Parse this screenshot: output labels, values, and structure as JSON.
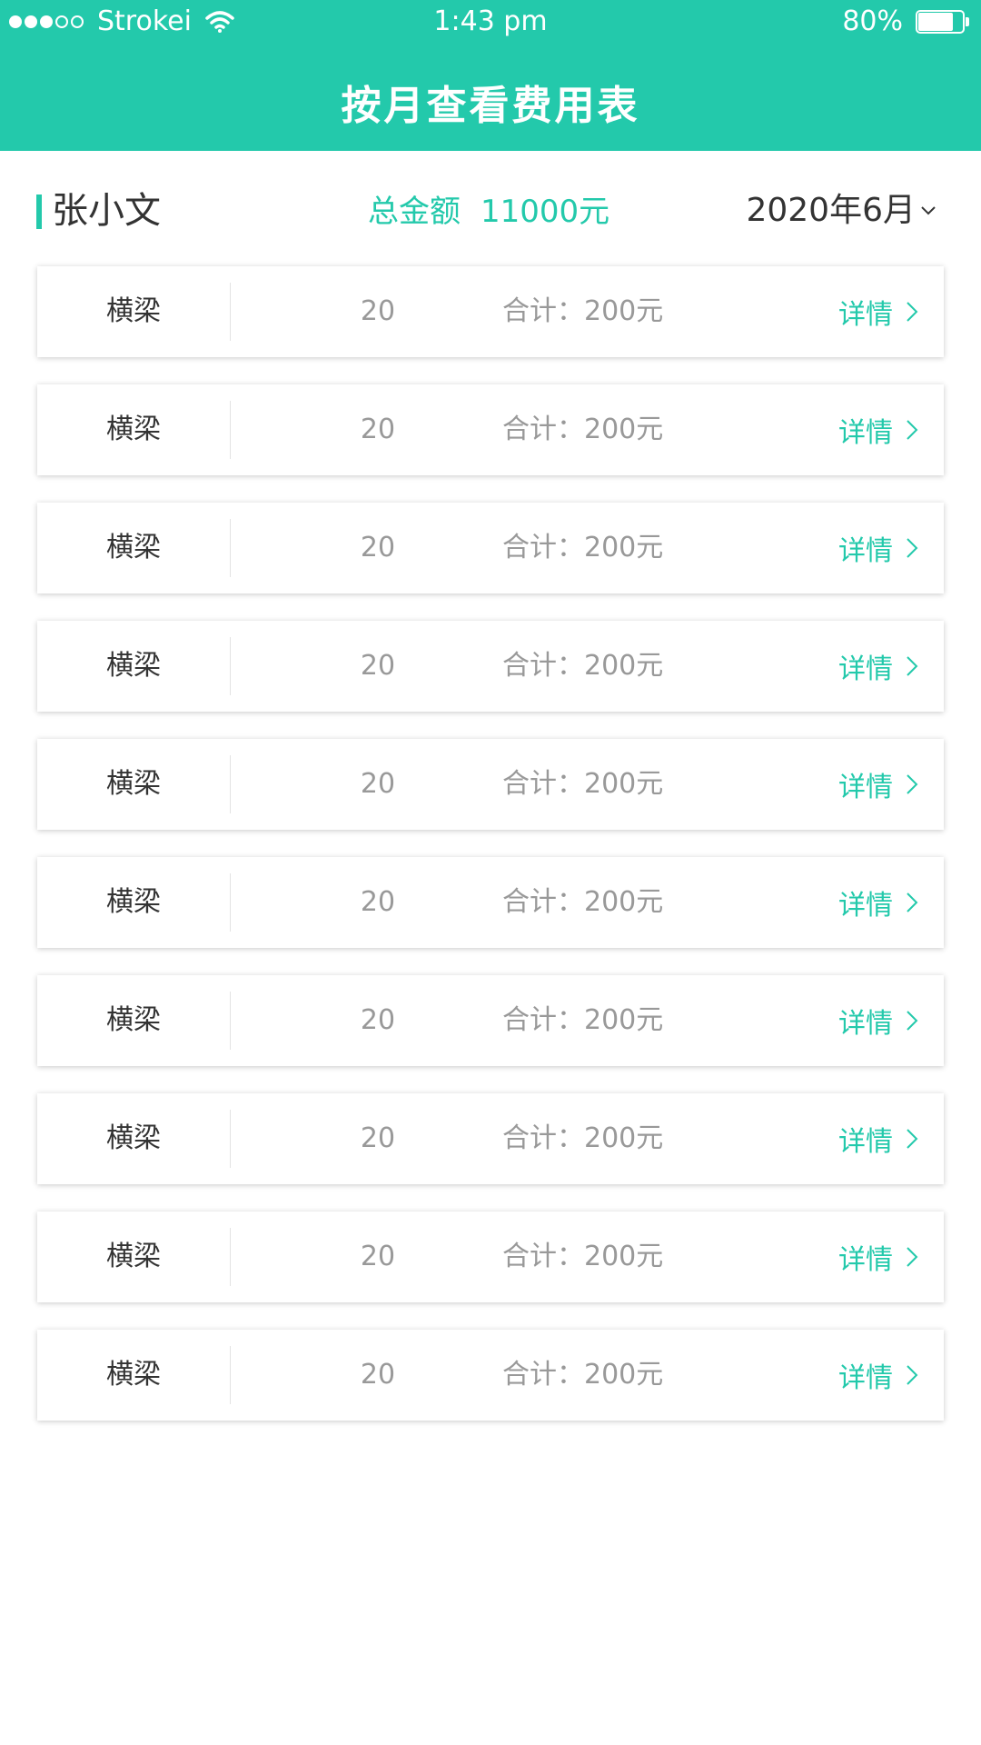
{
  "status_bar": {
    "carrier": "Strokei",
    "time": "1:43 pm",
    "battery": "80%",
    "battery_level": 0.8,
    "signal_bars_filled": 3,
    "signal_bars_total": 5
  },
  "header": {
    "title": "按月查看费用表"
  },
  "summary": {
    "name": "张小文",
    "total_label": "总金额",
    "total_value": "11000元",
    "month": "2020年6月"
  },
  "items": [
    {
      "name": "横梁",
      "quantity": "20",
      "total": "合计：200元",
      "detail": "详情"
    },
    {
      "name": "横梁",
      "quantity": "20",
      "total": "合计：200元",
      "detail": "详情"
    },
    {
      "name": "横梁",
      "quantity": "20",
      "total": "合计：200元",
      "detail": "详情"
    },
    {
      "name": "横梁",
      "quantity": "20",
      "total": "合计：200元",
      "detail": "详情"
    },
    {
      "name": "横梁",
      "quantity": "20",
      "total": "合计：200元",
      "detail": "详情"
    },
    {
      "name": "横梁",
      "quantity": "20",
      "total": "合计：200元",
      "detail": "详情"
    },
    {
      "name": "横梁",
      "quantity": "20",
      "total": "合计：200元",
      "detail": "详情"
    },
    {
      "name": "横梁",
      "quantity": "20",
      "total": "合计：200元",
      "detail": "详情"
    },
    {
      "name": "横梁",
      "quantity": "20",
      "total": "合计：200元",
      "detail": "详情"
    },
    {
      "name": "横梁",
      "quantity": "20",
      "total": "合计：200元",
      "detail": "详情"
    }
  ],
  "colors": {
    "accent": "#23c9ab",
    "text_primary": "#333333",
    "text_secondary": "#999999"
  },
  "icons": {
    "signal": "signal-dots-icon",
    "wifi": "wifi-icon",
    "battery": "battery-icon",
    "month_dropdown": "chevron-down-icon",
    "row_detail": "chevron-right-icon"
  }
}
